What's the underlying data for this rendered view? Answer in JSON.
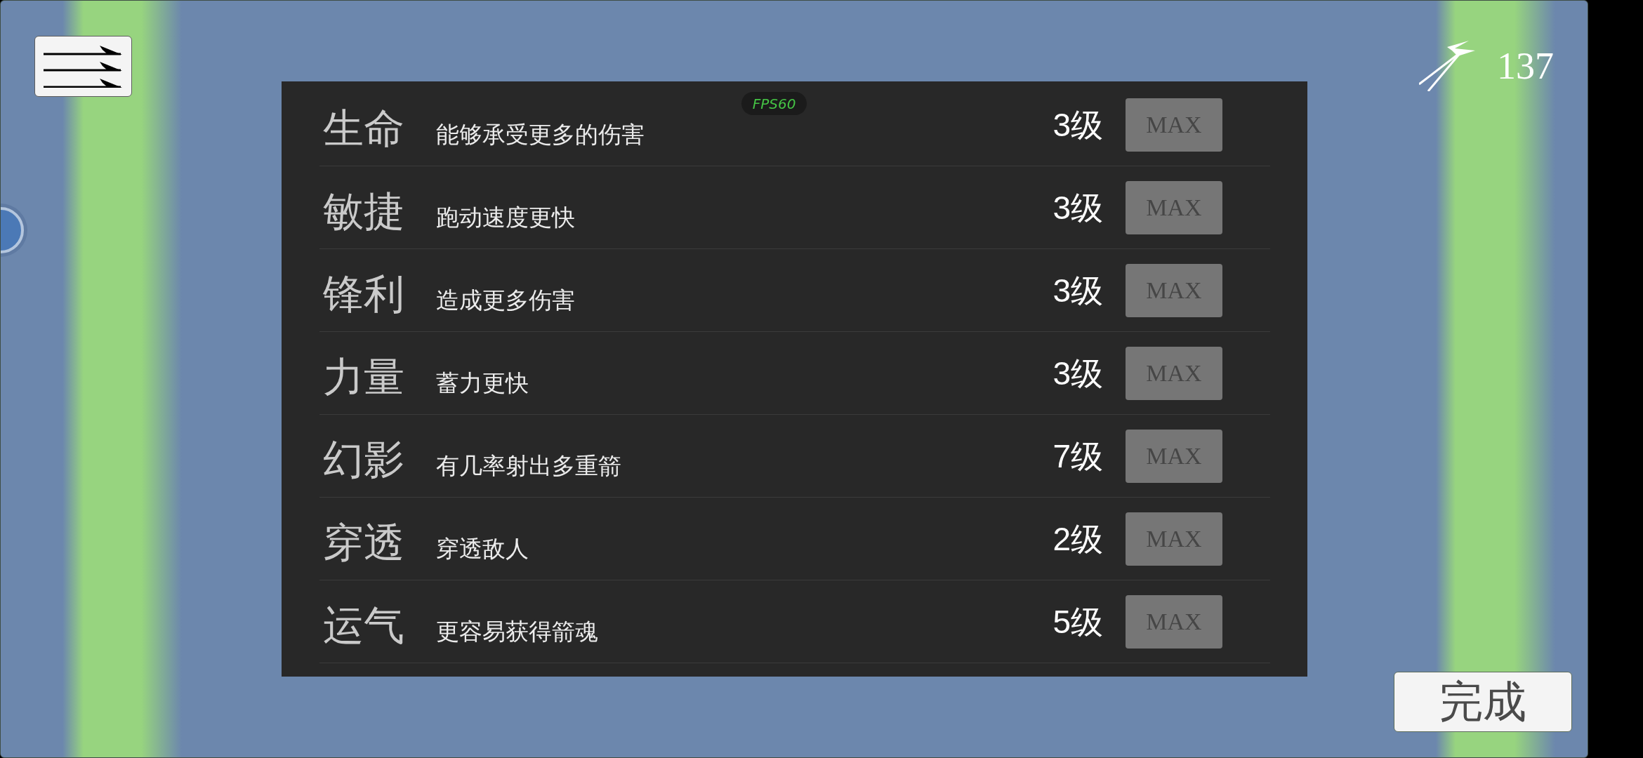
{
  "counter": {
    "value": "137"
  },
  "fps_badge": {
    "label": "FPS60"
  },
  "upgrades": [
    {
      "name": "生命",
      "description": "能够承受更多的伤害",
      "rank": "3级",
      "button": "MAX",
      "disabled": true
    },
    {
      "name": "敏捷",
      "description": "跑动速度更快",
      "rank": "3级",
      "button": "MAX",
      "disabled": true
    },
    {
      "name": "锋利",
      "description": "造成更多伤害",
      "rank": "3级",
      "button": "MAX",
      "disabled": true
    },
    {
      "name": "力量",
      "description": "蓄力更快",
      "rank": "3级",
      "button": "MAX",
      "disabled": true
    },
    {
      "name": "幻影",
      "description": "有几率射出多重箭",
      "rank": "7级",
      "button": "MAX",
      "disabled": true
    },
    {
      "name": "穿透",
      "description": "穿透敌人",
      "rank": "2级",
      "button": "MAX",
      "disabled": true
    },
    {
      "name": "运气",
      "description": "更容易获得箭魂",
      "rank": "5级",
      "button": "MAX",
      "disabled": true
    }
  ],
  "done_button": {
    "label": "完成"
  }
}
